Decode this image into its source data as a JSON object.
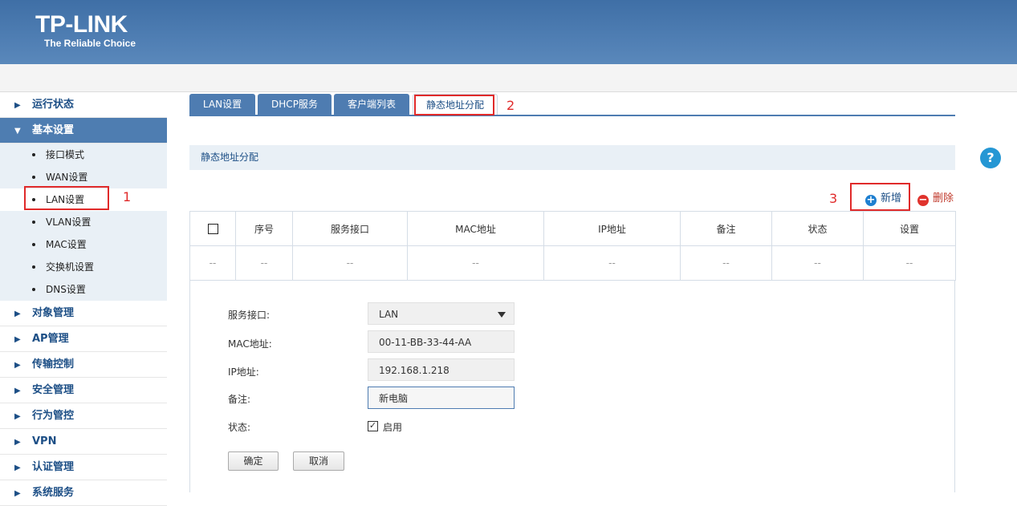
{
  "brand": {
    "name": "TP-LINK",
    "tagline": "The Reliable Choice"
  },
  "sidebar": {
    "groups": [
      {
        "label": "运行状态",
        "open": false
      },
      {
        "label": "基本设置",
        "open": true,
        "items": [
          "接口模式",
          "WAN设置",
          "LAN设置",
          "VLAN设置",
          "MAC设置",
          "交换机设置",
          "DNS设置"
        ],
        "active_item": "LAN设置"
      },
      {
        "label": "对象管理",
        "open": false
      },
      {
        "label": "AP管理",
        "open": false
      },
      {
        "label": "传输控制",
        "open": false
      },
      {
        "label": "安全管理",
        "open": false
      },
      {
        "label": "行为管控",
        "open": false
      },
      {
        "label": "VPN",
        "open": false
      },
      {
        "label": "认证管理",
        "open": false
      },
      {
        "label": "系统服务",
        "open": false
      }
    ]
  },
  "tabs": [
    {
      "label": "LAN设置"
    },
    {
      "label": "DHCP服务"
    },
    {
      "label": "客户端列表"
    },
    {
      "label": "静态地址分配",
      "active": true
    }
  ],
  "section": {
    "title": "静态地址分配"
  },
  "actions": {
    "add": "新增",
    "delete": "删除"
  },
  "annotations": {
    "a1": "1",
    "a2": "2",
    "a3": "3"
  },
  "colors": {
    "header": "#4f7eb3",
    "accent": "#1d4f86",
    "annotation": "#e02a2a",
    "help": "#2597d4"
  },
  "table": {
    "columns": [
      "",
      "序号",
      "服务接口",
      "MAC地址",
      "IP地址",
      "备注",
      "状态",
      "设置"
    ],
    "rows": [
      [
        "--",
        "--",
        "--",
        "--",
        "--",
        "--",
        "--",
        "--"
      ]
    ]
  },
  "form": {
    "interface_label": "服务接口:",
    "interface_value": "LAN",
    "mac_label": "MAC地址:",
    "mac_value": "00-11-BB-33-44-AA",
    "ip_label": "IP地址:",
    "ip_value": "192.168.1.218",
    "note_label": "备注:",
    "note_value": "新电脑",
    "status_label": "状态:",
    "status_option": "启用",
    "status_checked": true,
    "confirm": "确定",
    "cancel": "取消"
  }
}
